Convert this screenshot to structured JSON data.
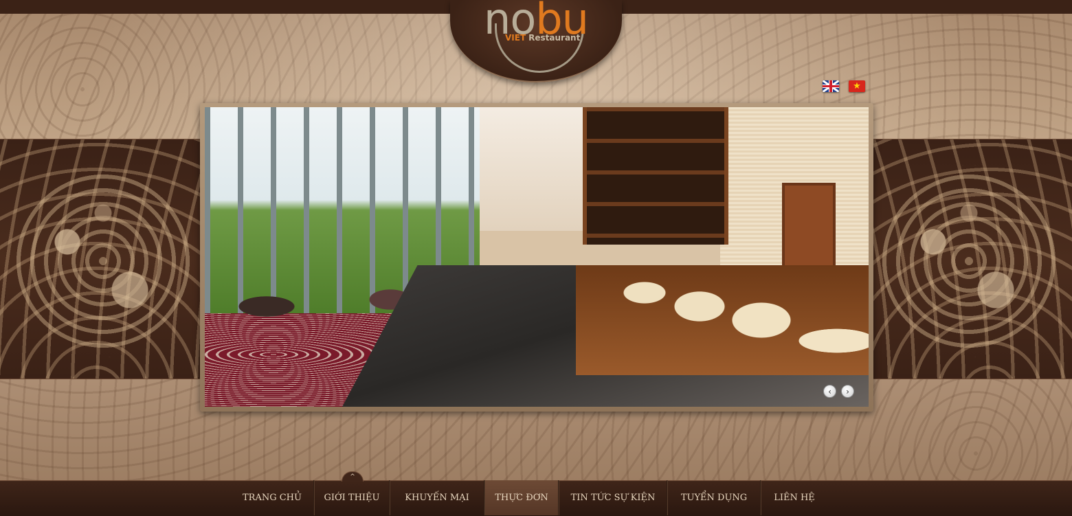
{
  "logo": {
    "word_part1": "no",
    "word_part2": "bu",
    "subtitle_accent": "VIET",
    "subtitle": "Restaurant",
    "accent_color": "#e07a1f"
  },
  "languages": [
    {
      "code": "en",
      "icon": "uk-flag-icon"
    },
    {
      "code": "vi",
      "icon": "vietnam-flag-icon",
      "glyph": "★"
    }
  ],
  "slider": {
    "prev_glyph": "‹",
    "next_glyph": "›"
  },
  "nav": {
    "arrow_glyph": "^",
    "items": [
      {
        "label": "TRANG CHỦ",
        "active": false
      },
      {
        "label": "GIỚI THIỆU",
        "active": false
      },
      {
        "label": "KHUYẾN MẠI",
        "active": false
      },
      {
        "label": "THỰC ĐƠN",
        "active": true
      },
      {
        "label": "TIN TỨC SỰ KIỆN",
        "active": false
      },
      {
        "label": "TUYỂN DỤNG",
        "active": false
      },
      {
        "label": "LIÊN HỆ",
        "active": false
      }
    ]
  },
  "colors": {
    "nav_text": "#e9d7bf",
    "band_dark": "#3a2116",
    "paisley": "#c7ab8d"
  }
}
